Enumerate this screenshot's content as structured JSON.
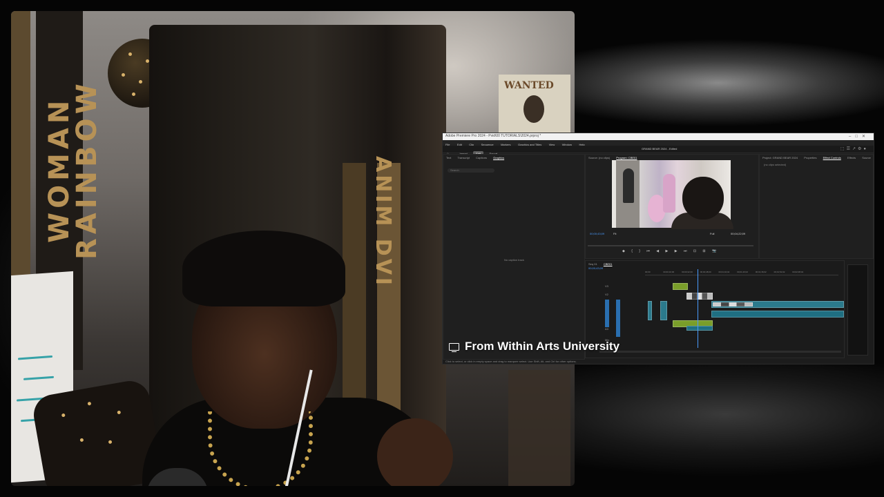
{
  "caption": {
    "text": "From Within Arts University",
    "icon": "monitor-icon"
  },
  "webcam": {
    "banner_left_text": "WOMAN RAINBOW",
    "banner_right_text": "ANIM DVI",
    "poster_text": "WANTED"
  },
  "premiere": {
    "window_title": "Adobe Premiere Pro 2024 - Pvid\\00 TUTORIALS\\2024.prproj *",
    "menus": [
      "File",
      "Edit",
      "Clip",
      "Sequence",
      "Markers",
      "Graphics and Titles",
      "View",
      "Window",
      "Help"
    ],
    "workspace_tabs": [
      "Import",
      "Edit",
      "Export"
    ],
    "active_workspace": "Edit",
    "project_title": "GRAND BEAR 2024 - Edited",
    "left_panel": {
      "tabs": [
        "Text",
        "Transcript",
        "Captions",
        "Graphics"
      ],
      "active_tab": "Graphics",
      "search_placeholder": "Search",
      "empty_message": "No caption track"
    },
    "program": {
      "tabs": [
        "Source: (no clips)",
        "Program: CBE01"
      ],
      "timecode_left": "00;00;43;09",
      "zoom": "Fit",
      "quality": "Full",
      "timecode_right": "00;04;22;09"
    },
    "effects": {
      "tabs": [
        "Project: GRAND BEAR 2024",
        "Properties",
        "Effect Controls",
        "Effects",
        "Source"
      ],
      "active_tab": "Effect Controls",
      "no_clip": "(no clips selected)"
    },
    "timeline": {
      "sequence_tabs": [
        "Seq 01",
        "CBE01"
      ],
      "timecode": "00;00;43;09",
      "tracks": [
        "V3",
        "V2",
        "V1",
        "A1",
        "A2",
        "A3",
        "Mix"
      ],
      "ruler": [
        "00;00",
        "00;00;16;00",
        "00;00;32;00",
        "00;00;48;00",
        "00;01;04;02",
        "00;01;20;02",
        "00;01;36;02",
        "00;01;52;02",
        "00;02;08;04"
      ]
    },
    "status_text": "Click to select, or click in empty space and drag to marquee select. Use Shift, Alt, and Ctrl for other options."
  }
}
